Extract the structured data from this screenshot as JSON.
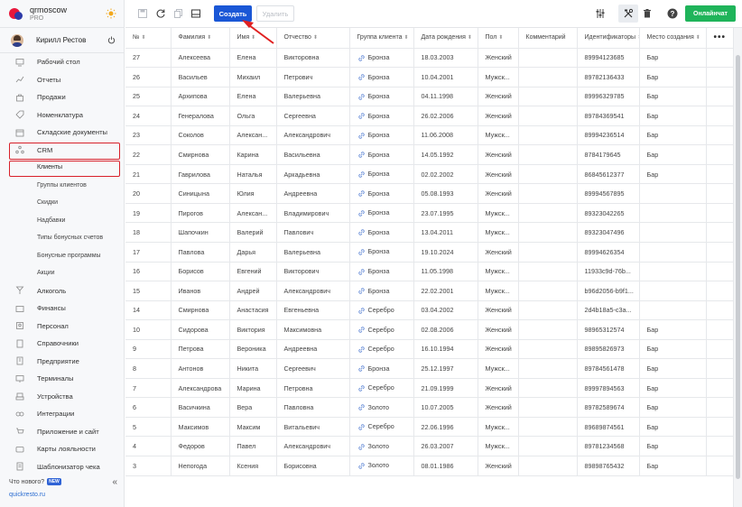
{
  "brand": {
    "name": "qrmoscow",
    "plan": "PRO"
  },
  "user": {
    "name": "Кирилл Рестов"
  },
  "menu": [
    {
      "label": "Рабочий стол",
      "icon": "desktop-icon"
    },
    {
      "label": "Отчеты",
      "icon": "chart-icon"
    },
    {
      "label": "Продажи",
      "icon": "bag-icon"
    },
    {
      "label": "Номенклатура",
      "icon": "tag-icon"
    },
    {
      "label": "Складские документы",
      "icon": "box-icon"
    },
    {
      "label": "CRM",
      "icon": "crm-icon"
    }
  ],
  "crm_sub": [
    "Клиенты",
    "Группы клиентов",
    "Скидки",
    "Надбавки",
    "Типы бонусных счетов",
    "Бонусные программы",
    "Акции"
  ],
  "menu2": [
    {
      "label": "Алкоголь",
      "icon": "glass-icon"
    },
    {
      "label": "Финансы",
      "icon": "wallet-icon"
    },
    {
      "label": "Персонал",
      "icon": "staff-icon"
    },
    {
      "label": "Справочники",
      "icon": "book-icon"
    },
    {
      "label": "Предприятие",
      "icon": "building-icon"
    },
    {
      "label": "Терминалы",
      "icon": "terminal-icon"
    },
    {
      "label": "Устройства",
      "icon": "device-icon"
    },
    {
      "label": "Интеграции",
      "icon": "link-icon"
    },
    {
      "label": "Приложение и сайт",
      "icon": "cart-icon"
    },
    {
      "label": "Карты лояльности",
      "icon": "card-icon"
    },
    {
      "label": "Шаблонизатор чека",
      "icon": "receipt-icon"
    }
  ],
  "sidebar_bottom": {
    "whats_new": "Что нового?",
    "badge": "NEW",
    "site": "quickresto.ru"
  },
  "toolbar": {
    "create": "Создать",
    "delete": "Удалить",
    "chat": "Онлайнчат"
  },
  "colors": {
    "primary": "#1a57d6",
    "chat": "#1fb45a",
    "highlight": "#d8202a",
    "bronze": "#6a8fd8"
  },
  "table": {
    "headers": [
      "№",
      "Фамилия",
      "Имя",
      "Отчество",
      "Группа клиента",
      "Дата рождения",
      "Пол",
      "Комментарий",
      "Идентификаторы",
      "Место создания"
    ],
    "rows": [
      [
        "27",
        "Алексеева",
        "Елена",
        "Викторовна",
        "Бронза",
        "18.03.2003",
        "Женский",
        "",
        "89994123685",
        "Бар"
      ],
      [
        "26",
        "Васильев",
        "Михаил",
        "Петрович",
        "Бронза",
        "10.04.2001",
        "Мужск...",
        "",
        "89782136433",
        "Бар"
      ],
      [
        "25",
        "Архипова",
        "Елена",
        "Валерьевна",
        "Бронза",
        "04.11.1998",
        "Женский",
        "",
        "89996329785",
        "Бар"
      ],
      [
        "24",
        "Генералова",
        "Ольга",
        "Сергеевна",
        "Бронза",
        "26.02.2006",
        "Женский",
        "",
        "89784369541",
        "Бар"
      ],
      [
        "23",
        "Соколов",
        "Алексан...",
        "Александрович",
        "Бронза",
        "11.06.2008",
        "Мужск...",
        "",
        "89994236514",
        "Бар"
      ],
      [
        "22",
        "Смирнова",
        "Карина",
        "Васильевна",
        "Бронза",
        "14.05.1992",
        "Женский",
        "",
        "8784179645",
        "Бар"
      ],
      [
        "21",
        "Гаврилова",
        "Наталья",
        "Аркадьевна",
        "Бронза",
        "02.02.2002",
        "Женский",
        "",
        "86845612377",
        "Бар"
      ],
      [
        "20",
        "Синицына",
        "Юлия",
        "Андреевна",
        "Бронза",
        "05.08.1993",
        "Женский",
        "",
        "89994567895",
        ""
      ],
      [
        "19",
        "Пирогов",
        "Алексан...",
        "Владимирович",
        "Бронза",
        "23.07.1995",
        "Мужск...",
        "",
        "89323042265",
        ""
      ],
      [
        "18",
        "Шапочкин",
        "Валерий",
        "Павлович",
        "Бронза",
        "13.04.2011",
        "Мужск...",
        "",
        "89323047496",
        ""
      ],
      [
        "17",
        "Павлова",
        "Дарья",
        "Валерьевна",
        "Бронза",
        "19.10.2024",
        "Женский",
        "",
        "89994626354",
        ""
      ],
      [
        "16",
        "Борисов",
        "Евгений",
        "Викторович",
        "Бронза",
        "11.05.1998",
        "Мужск...",
        "",
        "11933c9d-76b...",
        ""
      ],
      [
        "15",
        "Иванов",
        "Андрей",
        "Александрович",
        "Бронза",
        "22.02.2001",
        "Мужск...",
        "",
        "b96d2056-b9f1...",
        ""
      ],
      [
        "14",
        "Смирнова",
        "Анастасия",
        "Евгеньевна",
        "Серебро",
        "03.04.2002",
        "Женский",
        "",
        "2d4b18a5-c3a...",
        ""
      ],
      [
        "10",
        "Сидорова",
        "Виктория",
        "Максимовна",
        "Серебро",
        "02.08.2006",
        "Женский",
        "",
        "98965312574",
        "Бар"
      ],
      [
        "9",
        "Петрова",
        "Вероника",
        "Андреевна",
        "Серебро",
        "16.10.1994",
        "Женский",
        "",
        "89895826973",
        "Бар"
      ],
      [
        "8",
        "Антонов",
        "Никита",
        "Сергеевич",
        "Бронза",
        "25.12.1997",
        "Мужск...",
        "",
        "89784561478",
        "Бар"
      ],
      [
        "7",
        "Александрова",
        "Марина",
        "Петровна",
        "Серебро",
        "21.09.1999",
        "Женский",
        "",
        "89997894563",
        "Бар"
      ],
      [
        "6",
        "Васичкина",
        "Вера",
        "Павловна",
        "Золото",
        "10.07.2005",
        "Женский",
        "",
        "89782589674",
        "Бар"
      ],
      [
        "5",
        "Максимов",
        "Максим",
        "Витальевич",
        "Серебро",
        "22.06.1996",
        "Мужск...",
        "",
        "89689874561",
        "Бар"
      ],
      [
        "4",
        "Федоров",
        "Павел",
        "Александрович",
        "Золото",
        "26.03.2007",
        "Мужск...",
        "",
        "89781234568",
        "Бар"
      ],
      [
        "3",
        "Непогода",
        "Ксения",
        "Борисовна",
        "Золото",
        "08.01.1986",
        "Женский",
        "",
        "89898765432",
        "Бар"
      ]
    ]
  }
}
